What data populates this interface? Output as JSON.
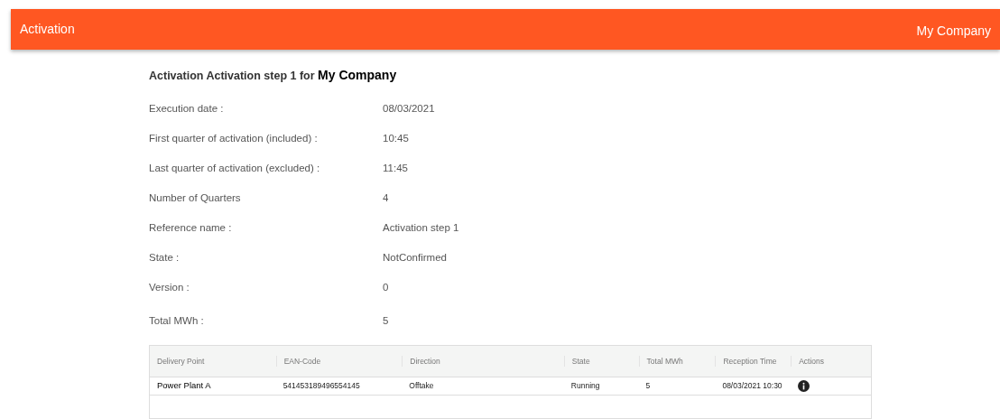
{
  "app_bar": {
    "title": "Activation",
    "company": "My Company"
  },
  "heading": "Activation Activation step 1 for **My Company**",
  "details": [
    {
      "label": "Execution date :",
      "value": "08/03/2021"
    },
    {
      "label": "First quarter of activation (included) :",
      "value": "10:45"
    },
    {
      "label": "Last quarter of activation (excluded) :",
      "value": "11:45"
    },
    {
      "label": "Number of Quarters",
      "value": "4"
    },
    {
      "label": "Reference name :",
      "value": "Activation step 1"
    },
    {
      "label": "State :",
      "value": "NotConfirmed"
    },
    {
      "label": "Version :",
      "value": "0"
    },
    {
      "label": "Total MWh :",
      "value": "5"
    }
  ],
  "table": {
    "columns": [
      "Delivery Point",
      "EAN-Code",
      "Direction",
      "State",
      "Total MWh",
      "Reception Time",
      "Actions"
    ],
    "rows": [
      {
        "cells": [
          "Power Plant A",
          "541453189496554145",
          "Offtake",
          "Running",
          "5",
          "08/03/2021 10:30"
        ],
        "info_action": true
      }
    ]
  }
}
